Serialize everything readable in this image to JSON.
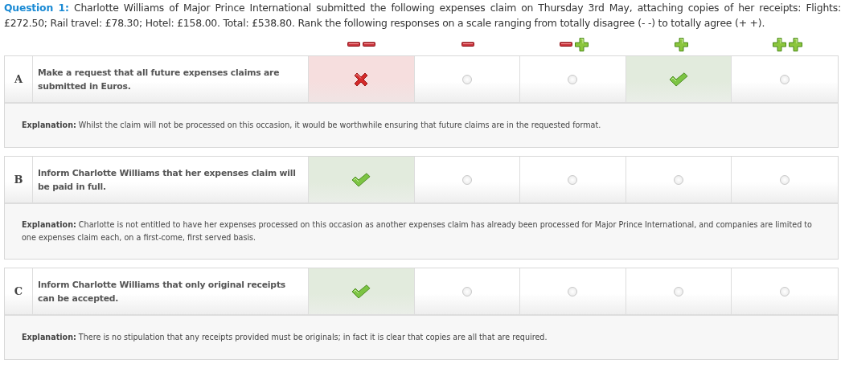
{
  "question": {
    "label": "Question 1:",
    "text": "Charlotte Williams of Major Prince International submitted the following expenses claim on Thursday 3rd May, attaching copies of her receipts: Flights: £272.50; Rail travel: £78.30; Hotel: £158.00. Total: £538.80. Rank the following responses on a scale ranging from totally disagree (- -) to totally agree (+ +)."
  },
  "scale": [
    {
      "icons": [
        {
          "kind": "minus"
        },
        {
          "kind": "minus"
        }
      ]
    },
    {
      "icons": [
        {
          "kind": "minus"
        }
      ]
    },
    {
      "icons": [
        {
          "kind": "minus"
        },
        {
          "kind": "plus"
        }
      ]
    },
    {
      "icons": [
        {
          "kind": "plus"
        }
      ]
    },
    {
      "icons": [
        {
          "kind": "plus"
        },
        {
          "kind": "plus"
        }
      ]
    }
  ],
  "responses": [
    {
      "letter": "A",
      "statement": "Make a request that all future expenses claims are submitted in Euros.",
      "cells": [
        {
          "kind": "wrong"
        },
        {
          "kind": "empty"
        },
        {
          "kind": "empty"
        },
        {
          "kind": "correct"
        },
        {
          "kind": "empty"
        }
      ],
      "explanation_label": "Explanation:",
      "explanation": "Whilst the claim will not be processed on this occasion, it would be worthwhile ensuring that future claims are in the requested format."
    },
    {
      "letter": "B",
      "statement": "Inform Charlotte Williams that her expenses claim will be paid in full.",
      "cells": [
        {
          "kind": "correct"
        },
        {
          "kind": "empty"
        },
        {
          "kind": "empty"
        },
        {
          "kind": "empty"
        },
        {
          "kind": "empty"
        }
      ],
      "explanation_label": "Explanation:",
      "explanation": "Charlotte is not entitled to have her expenses processed on this occasion as another expenses claim has already been processed for Major Prince International, and companies are limited to one expenses claim each, on a first-come, first served basis."
    },
    {
      "letter": "C",
      "statement": "Inform Charlotte Williams that only original receipts can be accepted.",
      "cells": [
        {
          "kind": "correct"
        },
        {
          "kind": "empty"
        },
        {
          "kind": "empty"
        },
        {
          "kind": "empty"
        },
        {
          "kind": "empty"
        }
      ],
      "explanation_label": "Explanation:",
      "explanation": "There is no stipulation that any receipts provided must be originals; in fact it is clear that copies are all that are required."
    }
  ]
}
